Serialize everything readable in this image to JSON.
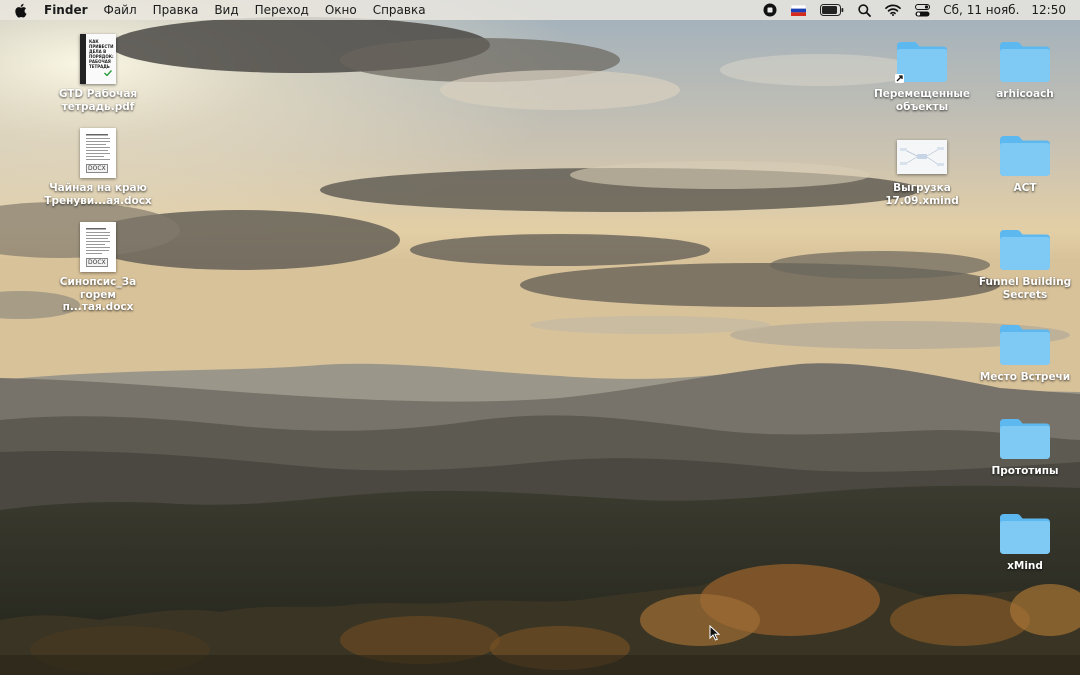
{
  "menubar": {
    "app_name": "Finder",
    "menus": [
      "Файл",
      "Правка",
      "Вид",
      "Переход",
      "Окно",
      "Справка"
    ],
    "status_icons": [
      "record-icon",
      "russian-flag-icon",
      "battery-icon",
      "search-icon",
      "wifi-icon",
      "control-center-icon"
    ],
    "date": "Сб, 11 нояб.",
    "time": "12:50"
  },
  "desktop": {
    "left_icons": [
      {
        "label": "GTD Рабочая тетрадь.pdf",
        "type": "pdf",
        "cover_text": "КАК ПРИВЕСТИ ДЕЛА В ПОРЯДОК: РАБОЧАЯ ТЕТРАДЬ"
      },
      {
        "label": "Чайная на краю Тренуви...ая.docx",
        "type": "docx",
        "badge": "DOCX"
      },
      {
        "label": "Синопсис_За горем п...тая.docx",
        "type": "docx",
        "badge": "DOCX"
      }
    ],
    "middle_icons": [
      {
        "label": "Перемещенные объекты",
        "type": "folder-alias"
      },
      {
        "label": "Выгрузка 17.09.xmind",
        "type": "xmind"
      }
    ],
    "right_icons": [
      {
        "label": "arhicoach",
        "type": "folder"
      },
      {
        "label": "ACT",
        "type": "folder"
      },
      {
        "label": "Funnel Building Secrets",
        "type": "folder"
      },
      {
        "label": "Место Встречи",
        "type": "folder"
      },
      {
        "label": "Прототипы",
        "type": "folder"
      },
      {
        "label": "xMind",
        "type": "folder"
      }
    ]
  },
  "colors": {
    "folder": "#5db8ef",
    "folder_top": "#7fcaf5",
    "menubar_bg": "#ece8e1"
  }
}
